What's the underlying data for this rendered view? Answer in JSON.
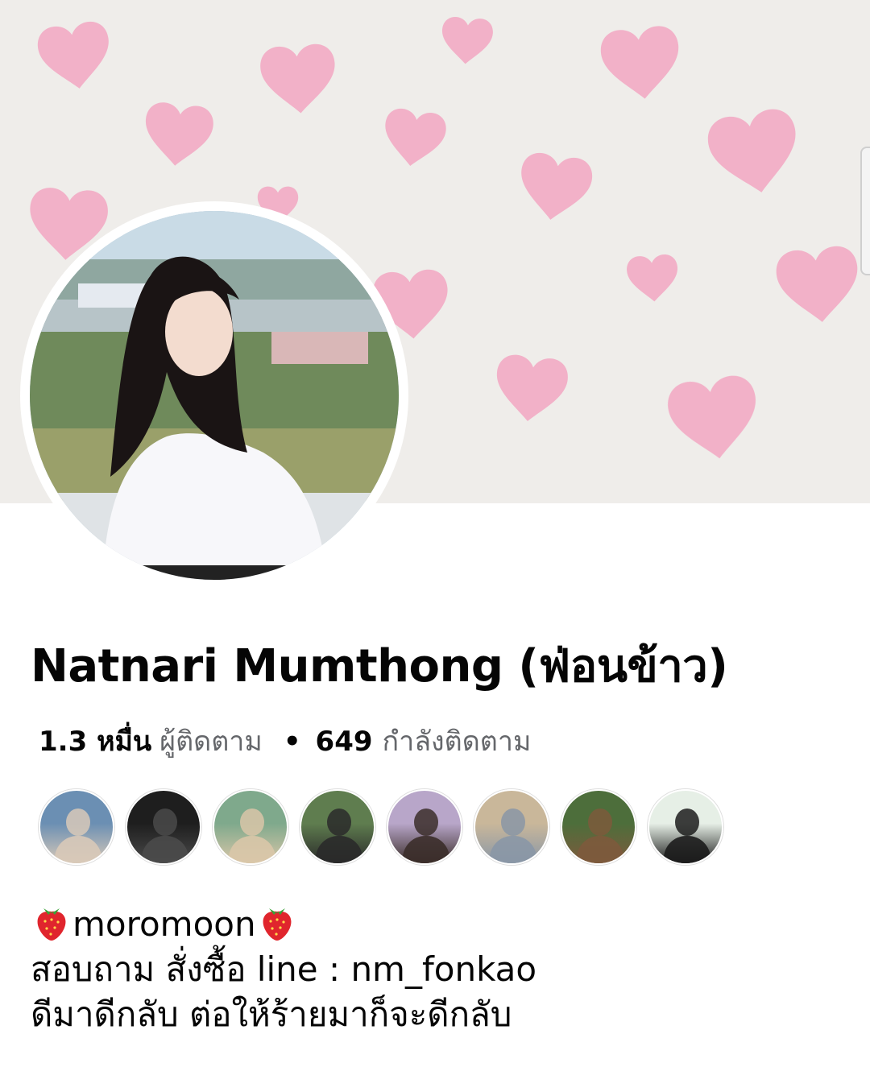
{
  "profile": {
    "name": "Natnari Mumthong (ฟ่อนข้าว)",
    "followers_count": "1.3 หมื่น",
    "followers_label": "ผู้ติดตาม",
    "separator": "•",
    "following_count": "649",
    "following_label": "กำลังติดตาม"
  },
  "friends": [
    {
      "name": "friend-avatar-1",
      "colors": [
        "#6b8fb3",
        "#d8c9b8"
      ]
    },
    {
      "name": "friend-avatar-2",
      "colors": [
        "#1e1e1e",
        "#4a4a4a"
      ]
    },
    {
      "name": "friend-avatar-3",
      "colors": [
        "#7fa98c",
        "#d9c6a8"
      ]
    },
    {
      "name": "friend-avatar-4",
      "colors": [
        "#5f7d4f",
        "#2a2a2a"
      ]
    },
    {
      "name": "friend-avatar-5",
      "colors": [
        "#b8a6c9",
        "#3b2e2a"
      ]
    },
    {
      "name": "friend-avatar-6",
      "colors": [
        "#c9b79a",
        "#8a97a6"
      ]
    },
    {
      "name": "friend-avatar-7",
      "colors": [
        "#4d6e3b",
        "#7d5a3c"
      ]
    },
    {
      "name": "friend-avatar-8",
      "colors": [
        "#e6efe6",
        "#1c1c1c"
      ]
    }
  ],
  "bio": {
    "line1_text": "moromoon",
    "line1_icon": "strawberry-icon",
    "line2": "สอบถาม สั่งซื้อ line : nm_fonkao",
    "line3": "ดีมาดีกลับ ต่อให้ร้ายมาก็จะดีกลับ"
  },
  "colors": {
    "text": "#050505",
    "muted": "#65676b",
    "heart": "#f3a6c2",
    "cover_bg": "#efedea"
  }
}
